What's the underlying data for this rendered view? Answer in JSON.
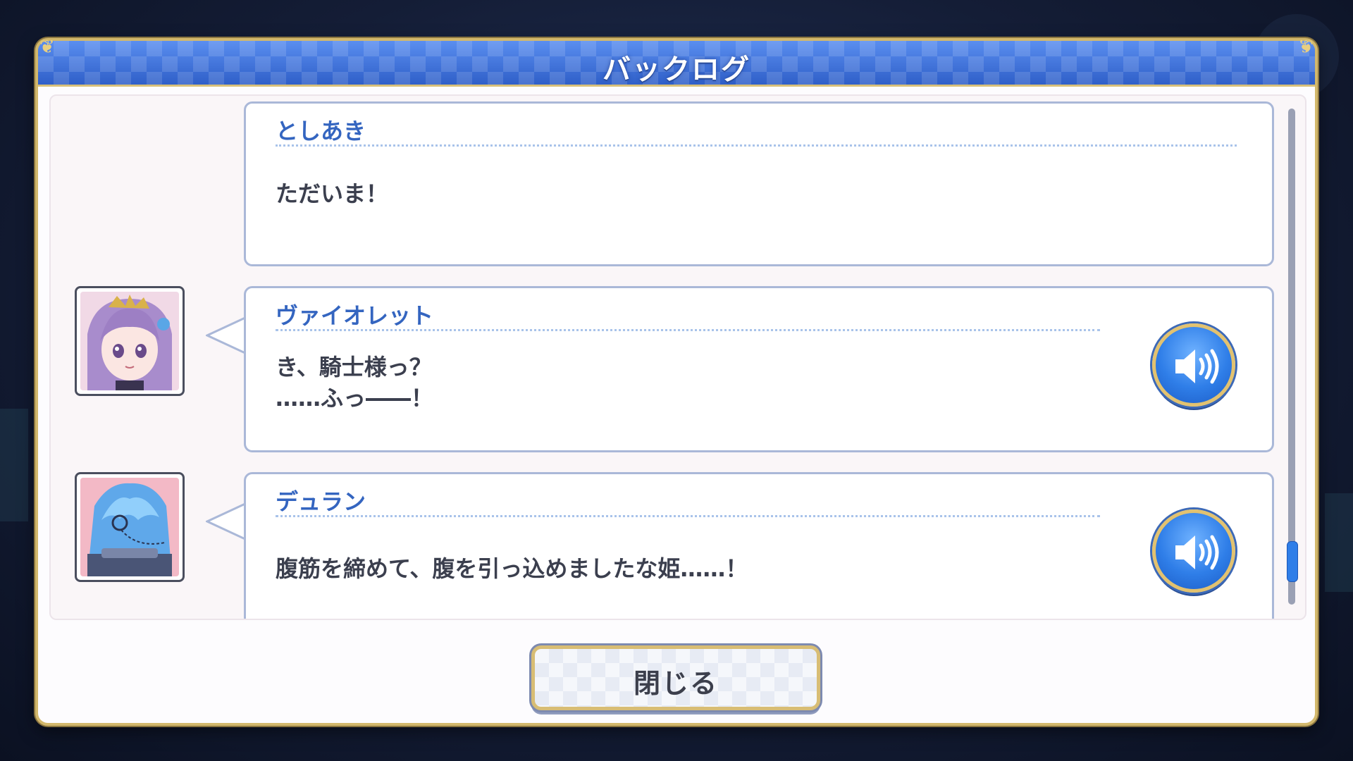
{
  "header": {
    "title": "バックログ"
  },
  "entries": [
    {
      "speaker": "としあき",
      "message": "ただいま！",
      "has_avatar": false,
      "has_voice": false
    },
    {
      "speaker": "ヴァイオレット",
      "message": "き、騎士様っ？\n……ふっ――！",
      "has_avatar": true,
      "avatar": "violet-portrait",
      "has_voice": true,
      "voice_icon": "speaker-icon"
    },
    {
      "speaker": "デュラン",
      "message": "腹筋を締めて、腹を引っ込めましたな姫……！",
      "has_avatar": true,
      "avatar": "duran-portrait",
      "has_voice": true,
      "voice_icon": "speaker-icon"
    }
  ],
  "scroll": {
    "position": 0.95
  },
  "footer": {
    "close_label": "閉じる"
  },
  "colors": {
    "accent_blue": "#3465c0",
    "gold_border": "#d2b86c",
    "voice_button": "#2f7ee8"
  }
}
